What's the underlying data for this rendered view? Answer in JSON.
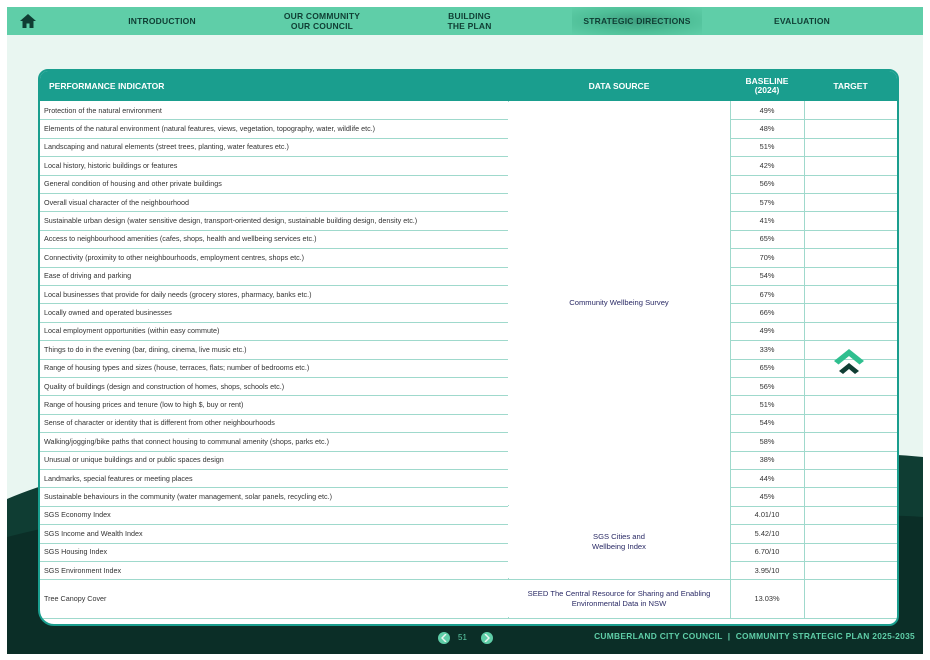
{
  "nav": {
    "home_icon": "home-icon",
    "items": [
      "INTRODUCTION",
      "OUR COMMUNITY\nOUR COUNCIL",
      "BUILDING\nTHE PLAN",
      "STRATEGIC DIRECTIONS",
      "EVALUATION"
    ],
    "active_index": 3
  },
  "table": {
    "headers": {
      "indicator": "PERFORMANCE INDICATOR",
      "source": "DATA SOURCE",
      "baseline": "BASELINE\n(2024)",
      "target": "TARGET"
    },
    "rows": [
      {
        "indicator": "Protection of the natural environment",
        "baseline": "49%"
      },
      {
        "indicator": "Elements of the natural environment (natural features, views, vegetation, topography, water, wildlife etc.)",
        "baseline": "48%"
      },
      {
        "indicator": "Landscaping and natural elements (street trees, planting, water features etc.)",
        "baseline": "51%"
      },
      {
        "indicator": "Local history, historic buildings or features",
        "baseline": "42%"
      },
      {
        "indicator": "General condition of housing and other private buildings",
        "baseline": "56%"
      },
      {
        "indicator": "Overall visual character of the neighbourhood",
        "baseline": "57%"
      },
      {
        "indicator": "Sustainable urban design (water sensitive design, transport-oriented design, sustainable building design, density etc.)",
        "baseline": "41%"
      },
      {
        "indicator": "Access to neighbourhood amenities (cafes, shops, health and wellbeing services etc.)",
        "baseline": "65%"
      },
      {
        "indicator": "Connectivity (proximity to other neighbourhoods, employment centres, shops etc.)",
        "baseline": "70%"
      },
      {
        "indicator": "Ease of driving and parking",
        "baseline": "54%"
      },
      {
        "indicator": "Local businesses that provide for daily needs (grocery stores, pharmacy, banks etc.)",
        "baseline": "67%"
      },
      {
        "indicator": "Locally owned and operated businesses",
        "baseline": "66%"
      },
      {
        "indicator": "Local employment opportunities (within easy commute)",
        "baseline": "49%"
      },
      {
        "indicator": "Things to do in the evening (bar, dining, cinema, live music etc.)",
        "baseline": "33%"
      },
      {
        "indicator": "Range of housing types and sizes (house, terraces, flats; number of bedrooms etc.)",
        "baseline": "65%"
      },
      {
        "indicator": "Quality of buildings (design and construction of homes, shops, schools etc.)",
        "baseline": "56%"
      },
      {
        "indicator": "Range of housing prices and tenure (low to high $, buy or rent)",
        "baseline": "51%"
      },
      {
        "indicator": "Sense of character or identity that is different from other neighbourhoods",
        "baseline": "54%"
      },
      {
        "indicator": "Walking/jogging/bike paths that connect housing to communal amenity (shops, parks etc.)",
        "baseline": "58%"
      },
      {
        "indicator": "Unusual or unique buildings and or public spaces design",
        "baseline": "38%"
      },
      {
        "indicator": "Landmarks, special features or meeting places",
        "baseline": "44%"
      },
      {
        "indicator": "Sustainable behaviours in the community (water management, solar panels, recycling etc.)",
        "baseline": "45%"
      },
      {
        "indicator": "SGS Economy Index",
        "baseline": "4.01/10"
      },
      {
        "indicator": "SGS Income and Wealth Index",
        "baseline": "5.42/10"
      },
      {
        "indicator": "SGS Housing Index",
        "baseline": "6.70/10"
      },
      {
        "indicator": "SGS Environment Index",
        "baseline": "3.95/10"
      },
      {
        "indicator": "Tree Canopy Cover",
        "baseline": "13.03%"
      }
    ],
    "source_groups": [
      {
        "label": "Community Wellbeing Survey",
        "first_row": 0,
        "last_row": 21
      },
      {
        "label": "SGS Cities and\nWellbeing Index",
        "first_row": 22,
        "last_row": 25
      },
      {
        "label": "SEED The Central Resource for Sharing and Enabling\nEnvironmental Data in NSW",
        "first_row": 26,
        "last_row": 26
      }
    ],
    "target_icon": "double-chevron-up-icon",
    "colors": {
      "header": "#1a9e8e",
      "nav": "#5fcea8",
      "target_icon_top": "#2fbf8f",
      "target_icon_bottom": "#0f3d33"
    }
  },
  "footer": {
    "page_number": "51",
    "text": "CUMBERLAND CITY COUNCIL  |  COMMUNITY STRATEGIC PLAN 2025-2035",
    "prev_icon": "chevron-left-icon",
    "next_icon": "chevron-right-icon"
  }
}
